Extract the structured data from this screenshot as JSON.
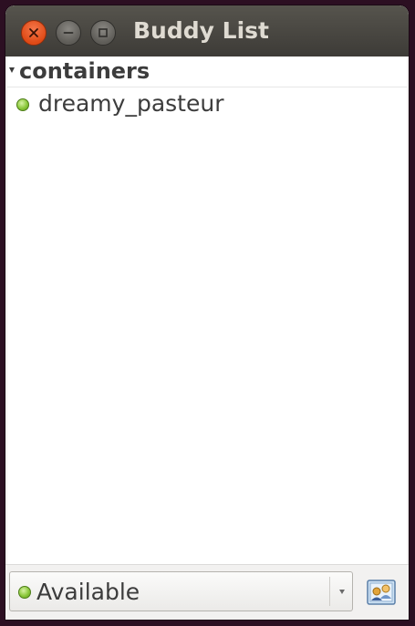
{
  "window": {
    "title": "Buddy List"
  },
  "buddy_list": {
    "group": {
      "label": "containers",
      "expanded": true
    },
    "buddies": [
      {
        "name": "dreamy_pasteur",
        "status": "available"
      }
    ]
  },
  "status_selector": {
    "value": "Available",
    "status_color": "#8bc83b"
  },
  "icons": {
    "close": "close-icon",
    "minimize": "minimize-icon",
    "maximize": "maximize-icon",
    "expander": "triangle-down-icon",
    "dropdown": "chevron-down-icon",
    "buddy_icon": "buddy-icon"
  }
}
